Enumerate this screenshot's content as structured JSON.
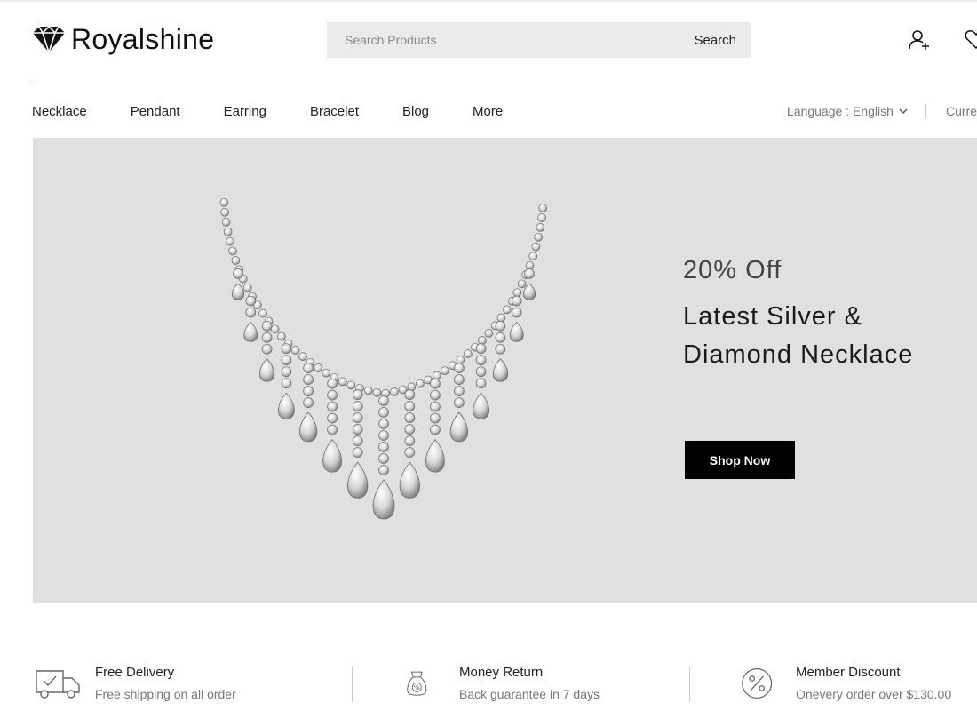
{
  "header": {
    "brand": "Royalshine",
    "search": {
      "placeholder": "Search Products",
      "button_label": "Search"
    }
  },
  "nav": {
    "items": [
      "Necklace",
      "Pendant",
      "Earring",
      "Bracelet",
      "Blog",
      "More"
    ],
    "language_label": "Language : English",
    "currency_label": "Curre"
  },
  "hero": {
    "offer": "20% Off",
    "title_line1": "Latest Silver &",
    "title_line2": "Diamond Necklace",
    "cta": "Shop Now",
    "background_color": "#e0e0e0"
  },
  "features": [
    {
      "icon": "delivery-truck-icon",
      "title": "Free Delivery",
      "desc": "Free shipping on all order"
    },
    {
      "icon": "money-bag-icon",
      "title": "Money Return",
      "desc": "Back guarantee in 7 days"
    },
    {
      "icon": "discount-percent-icon",
      "title": "Member Discount",
      "desc": "Onevery order over $130.00"
    }
  ],
  "colors": {
    "primary": "#000000",
    "text": "#222222",
    "muted": "#777777"
  }
}
